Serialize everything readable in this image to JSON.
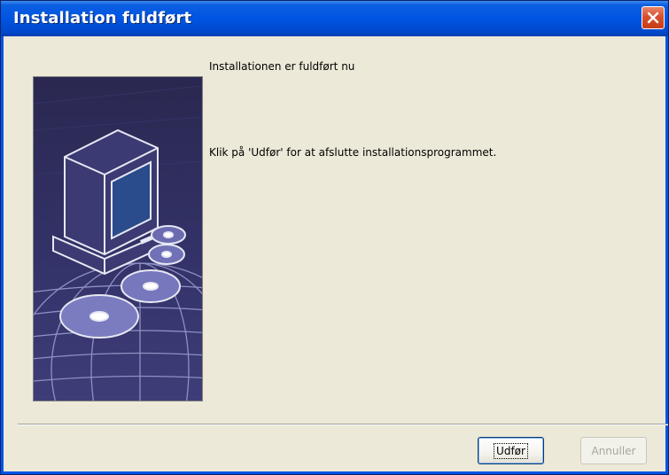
{
  "window": {
    "title": "Installation fuldført"
  },
  "content": {
    "line1": "Installationen er fuldført nu",
    "line2": "Klik på 'Udfør' for at afslutte installationsprogrammet."
  },
  "buttons": {
    "finish_label": "Udfør",
    "cancel_label": "Annuller",
    "cancel_enabled": false
  },
  "icons": {
    "close": "close-icon",
    "art": "computer-disc-globe-illustration"
  },
  "colors": {
    "titlebar": "#0054e3",
    "dialog_bg": "#ece9d8",
    "close_button": "#d6502c",
    "art_bg": "#2c2b52"
  }
}
